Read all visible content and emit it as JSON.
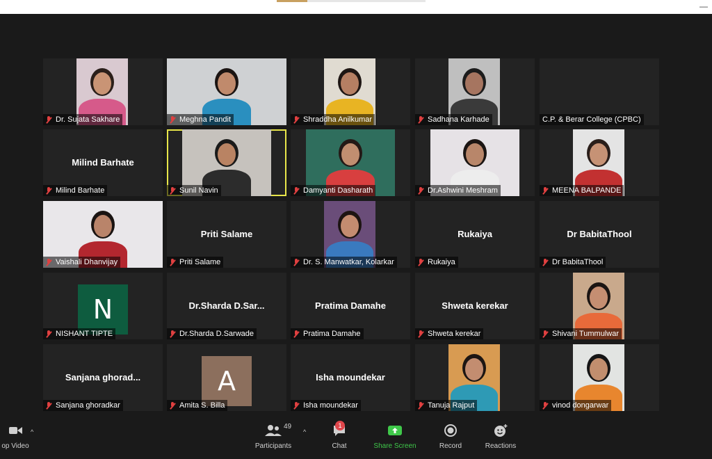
{
  "participants": [
    {
      "name": "Dr. Sujata Sakhare",
      "mode": "video",
      "bg": "#d9c9d0",
      "shirt": "#d65a8a",
      "skin": "#c99475",
      "hair": "#2b1f1a",
      "frameLeft": 48,
      "frameWidth": 74
    },
    {
      "name": "Meghna Pandit",
      "mode": "video",
      "bg": "#cfd1d3",
      "shirt": "#2a8fbf",
      "skin": "#c08a6c",
      "hair": "#1b1412",
      "frameLeft": 0,
      "frameWidth": 172
    },
    {
      "name": "Shraddha Anilkumar",
      "mode": "video",
      "bg": "#e0dbd1",
      "shirt": "#e8b423",
      "skin": "#b57f63",
      "hair": "#1e1613",
      "frameLeft": 48,
      "frameWidth": 74
    },
    {
      "name": "Sadhana Karhade",
      "mode": "video",
      "bg": "#bfbfbf",
      "shirt": "#3a3a3a",
      "skin": "#a67560",
      "hair": "#1c1c1c",
      "frameLeft": 48,
      "frameWidth": 74
    },
    {
      "name": "C.P. & Berar College (CPBC)",
      "mode": "blank"
    },
    {
      "name": "Milind Barhate",
      "mode": "name",
      "display": "Milind Barhate"
    },
    {
      "name": "Sunil Navin",
      "mode": "video",
      "active": true,
      "bg": "#c6c2bd",
      "shirt": "#2c2c2c",
      "skin": "#b98363",
      "hair": "#1a1a1a",
      "frameLeft": 22,
      "frameWidth": 128
    },
    {
      "name": "Damyanti Dasharath",
      "mode": "video",
      "bg": "#2f6e5d",
      "shirt": "#d83f3f",
      "skin": "#c18e70",
      "hair": "#241916",
      "frameLeft": 22,
      "frameWidth": 128
    },
    {
      "name": "Dr.Ashwini Meshram",
      "mode": "video",
      "bg": "#e6e2e6",
      "shirt": "#ededed",
      "skin": "#b8866a",
      "hair": "#1b1513",
      "frameLeft": 22,
      "frameWidth": 128
    },
    {
      "name": "MEENA BALPANDE",
      "mode": "video",
      "bg": "#e4e4e4",
      "shirt": "#c23131",
      "skin": "#c69275",
      "hair": "#2a1e1a",
      "frameLeft": 48,
      "frameWidth": 74
    },
    {
      "name": "Vaishali Dhanvijay",
      "mode": "video",
      "bg": "#e9e7ea",
      "shirt": "#b3272f",
      "skin": "#b9846a",
      "hair": "#1a1412",
      "frameLeft": 0,
      "frameWidth": 172
    },
    {
      "name": "Priti Salame",
      "mode": "name",
      "display": "Priti Salame"
    },
    {
      "name": "Dr. S. Manwatkar, Kolarkar",
      "mode": "video",
      "bg": "#6a4d79",
      "shirt": "#3a7abf",
      "skin": "#c48c70",
      "hair": "#1d1412",
      "frameLeft": 48,
      "frameWidth": 74
    },
    {
      "name": "Rukaiya",
      "mode": "name",
      "display": "Rukaiya"
    },
    {
      "name": "Dr BabitaThool",
      "mode": "name",
      "display": "Dr BabitaThool"
    },
    {
      "name": "NISHANT TIPTE",
      "mode": "avatar",
      "letter": "N",
      "avatarColor": "#0e5c3f"
    },
    {
      "name": "Dr.Sharda D.Sarwade",
      "mode": "name",
      "display": "Dr.Sharda  D.Sar..."
    },
    {
      "name": "Pratima Damahe",
      "mode": "name",
      "display": "Pratima Damahe"
    },
    {
      "name": "Shweta kerekar",
      "mode": "name",
      "display": "Shweta kerekar"
    },
    {
      "name": "Shivani Tummulwar",
      "mode": "video",
      "bg": "#c9a98c",
      "shirt": "#e86a3a",
      "skin": "#c58e72",
      "hair": "#1b1513",
      "frameLeft": 48,
      "frameWidth": 74
    },
    {
      "name": "Sanjana ghoradkar",
      "mode": "name",
      "display": "Sanjana  ghorad..."
    },
    {
      "name": "Amita S. Billa",
      "mode": "avatar",
      "letter": "A",
      "avatarColor": "#8c6f5d"
    },
    {
      "name": "Isha moundekar",
      "mode": "name",
      "display": "Isha moundekar"
    },
    {
      "name": "Tanuja Rajput",
      "mode": "video",
      "bg": "#d89b52",
      "shirt": "#2e9ab5",
      "skin": "#c38d70",
      "hair": "#1d1613",
      "frameLeft": 48,
      "frameWidth": 74
    },
    {
      "name": "vinod dongarwar",
      "mode": "video",
      "bg": "#e2e4e2",
      "shirt": "#e8862e",
      "skin": "#c18e6e",
      "hair": "#151515",
      "frameLeft": 48,
      "frameWidth": 74
    }
  ],
  "toolbar": {
    "stop_video_label": "op Video",
    "participants_label": "Participants",
    "participants_count": "49",
    "chat_label": "Chat",
    "chat_badge": "1",
    "share_screen_label": "Share Screen",
    "record_label": "Record",
    "reactions_label": "Reactions",
    "share_color": "#3fc84a"
  }
}
